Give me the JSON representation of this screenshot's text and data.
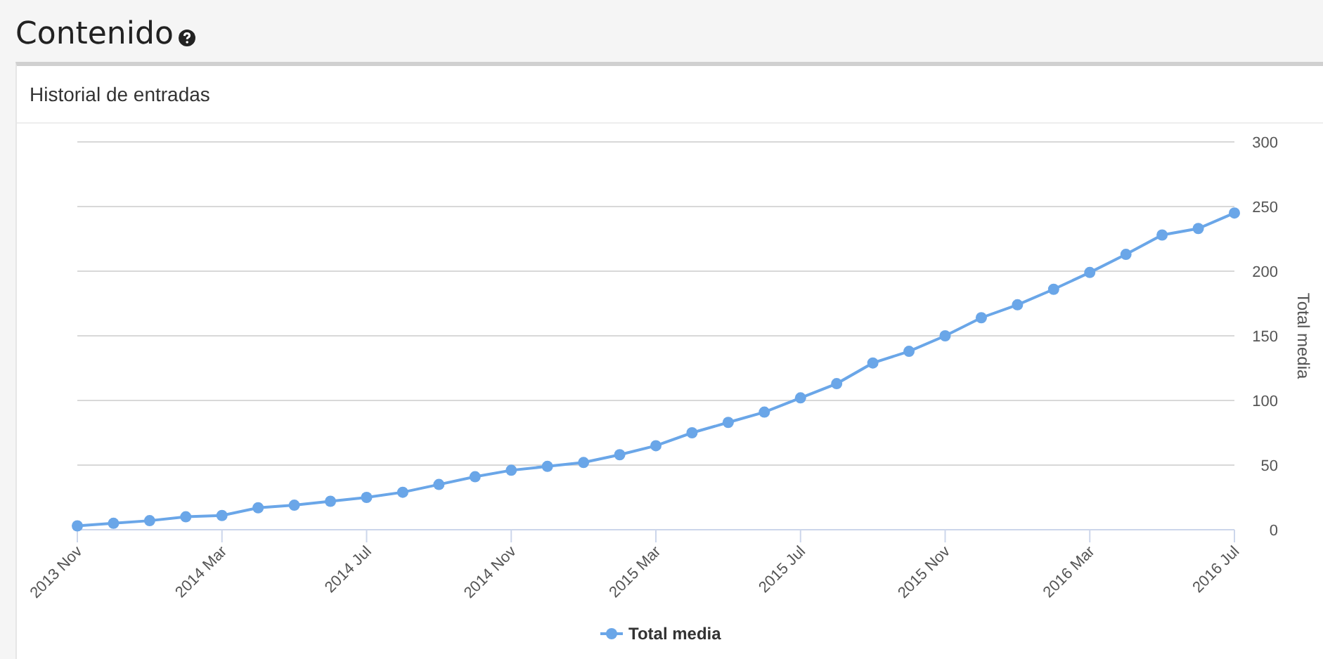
{
  "page": {
    "title": "Contenido"
  },
  "card": {
    "title": "Historial de entradas",
    "chart_data": {
      "type": "line",
      "ylabel": "Total media",
      "categories": [
        "2013 Nov",
        null,
        null,
        null,
        "2014 Mar",
        null,
        null,
        null,
        "2014 Jul",
        null,
        null,
        null,
        "2014 Nov",
        null,
        null,
        null,
        "2015 Mar",
        null,
        null,
        null,
        "2015 Jul",
        null,
        null,
        null,
        "2015 Nov",
        null,
        null,
        null,
        "2016 Mar",
        null,
        null,
        null,
        "2016 Jul"
      ],
      "grid": true,
      "ylim": [
        0,
        300
      ],
      "yticks": [
        0,
        50,
        100,
        150,
        200,
        250,
        300
      ],
      "series": [
        {
          "name": "Total media",
          "color": "#6aa6e8",
          "marker": "circle",
          "values": [
            3,
            5,
            7,
            10,
            11,
            17,
            19,
            22,
            25,
            29,
            35,
            41,
            46,
            49,
            52,
            58,
            65,
            75,
            83,
            91,
            102,
            113,
            129,
            138,
            150,
            164,
            174,
            186,
            199,
            213,
            228,
            233,
            245
          ]
        }
      ]
    }
  }
}
